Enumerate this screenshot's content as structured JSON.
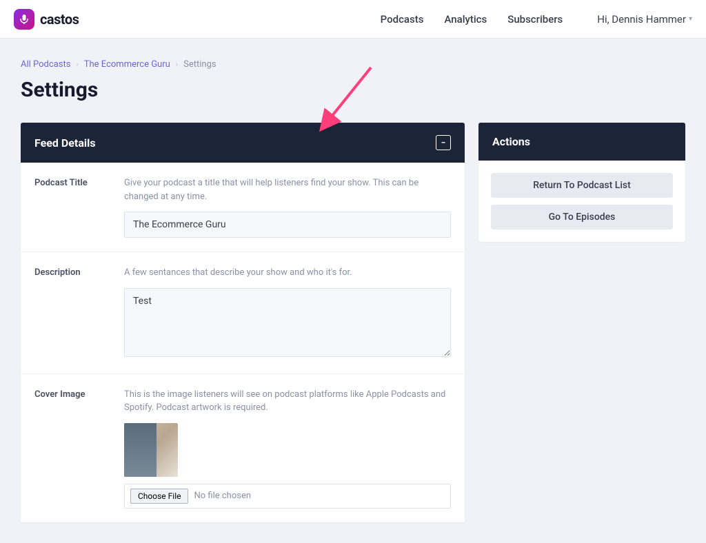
{
  "brand": {
    "name": "castos"
  },
  "nav": {
    "items": [
      "Podcasts",
      "Analytics",
      "Subscribers"
    ],
    "user_greeting": "Hi, Dennis Hammer"
  },
  "breadcrumb": {
    "items": [
      "All Podcasts",
      "The Ecommerce Guru"
    ],
    "current": "Settings"
  },
  "page": {
    "title": "Settings"
  },
  "feed_panel": {
    "header": "Feed Details",
    "rows": {
      "title": {
        "label": "Podcast Title",
        "help": "Give your podcast a title that will help listeners find your show. This can be changed at any time.",
        "value": "The Ecommerce Guru"
      },
      "description": {
        "label": "Description",
        "help": "A few sentances that describe your show and who it's for.",
        "value": "Test"
      },
      "cover": {
        "label": "Cover Image",
        "help": "This is the image listeners will see on podcast platforms like Apple Podcasts and Spotify. Podcast artwork is required.",
        "choose_label": "Choose File",
        "file_status": "No file chosen"
      }
    }
  },
  "actions_panel": {
    "header": "Actions",
    "buttons": [
      "Return To Podcast List",
      "Go To Episodes"
    ]
  }
}
